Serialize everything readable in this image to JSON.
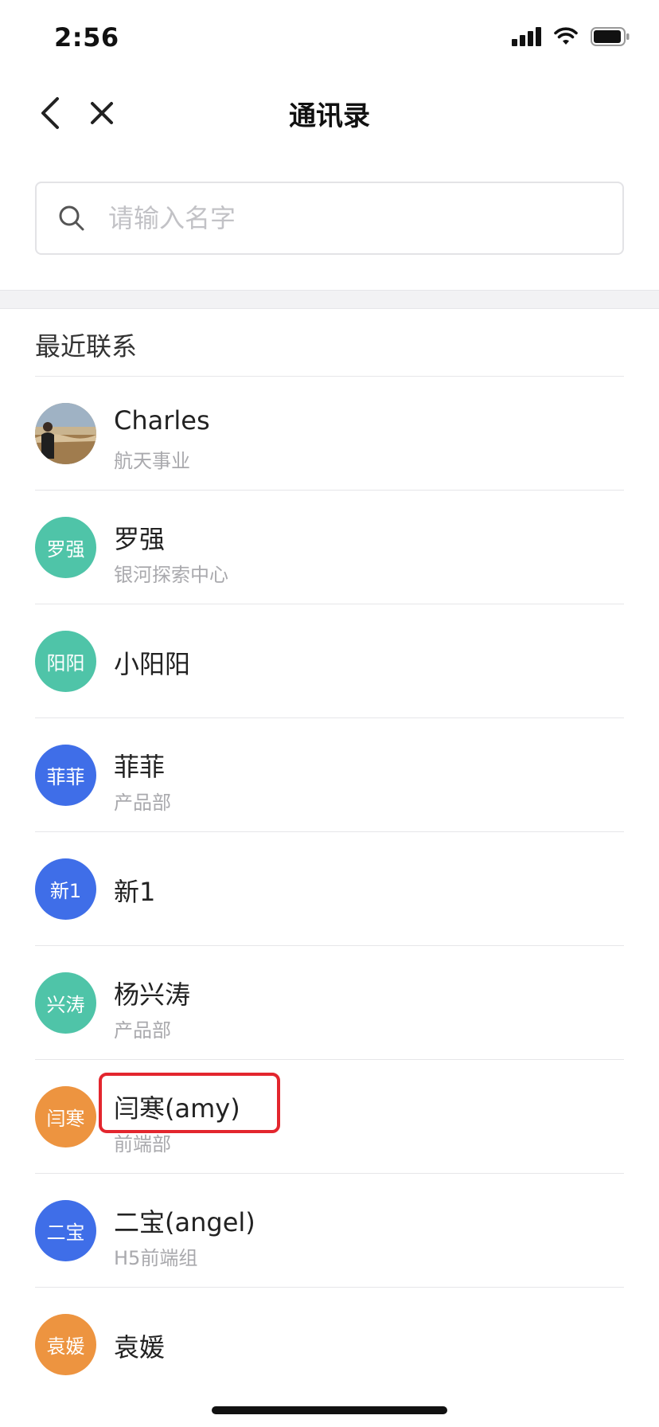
{
  "status_bar": {
    "time": "2:56",
    "icons": [
      "cellular-signal-icon",
      "wifi-icon",
      "battery-icon"
    ]
  },
  "nav": {
    "title": "通讯录",
    "back_icon": "chevron-left-icon",
    "close_icon": "close-icon"
  },
  "search": {
    "placeholder": "请输入名字",
    "value": "",
    "icon": "search-icon"
  },
  "section": {
    "title": "最近联系"
  },
  "contacts": [
    {
      "name": "Charles",
      "dept": "航天事业",
      "avatar_text": "",
      "avatar_type": "photo"
    },
    {
      "name": "罗强",
      "dept": "银河探索中心",
      "avatar_text": "罗强",
      "avatar_color": "#4fc4a8"
    },
    {
      "name": "小阳阳",
      "dept": "",
      "avatar_text": "阳阳",
      "avatar_color": "#4fc4a8"
    },
    {
      "name": "菲菲",
      "dept": "产品部",
      "avatar_text": "菲菲",
      "avatar_color": "#3f6ee8"
    },
    {
      "name": "新1",
      "dept": "",
      "avatar_text": "新1",
      "avatar_color": "#3f6ee8"
    },
    {
      "name": "杨兴涛",
      "dept": "产品部",
      "avatar_text": "兴涛",
      "avatar_color": "#4fc4a8"
    },
    {
      "name": "闫寒(amy)",
      "dept": "前端部",
      "avatar_text": "闫寒",
      "avatar_color": "#ed9440",
      "highlighted": true
    },
    {
      "name": "二宝(angel)",
      "dept": "H5前端组",
      "avatar_text": "二宝",
      "avatar_color": "#3f6ee8"
    },
    {
      "name": "袁媛",
      "dept": "",
      "avatar_text": "袁媛",
      "avatar_color": "#ed9440"
    }
  ],
  "colors": {
    "teal": "#4fc4a8",
    "blue": "#3f6ee8",
    "orange": "#ed9440",
    "highlight_red": "#e3262e"
  }
}
